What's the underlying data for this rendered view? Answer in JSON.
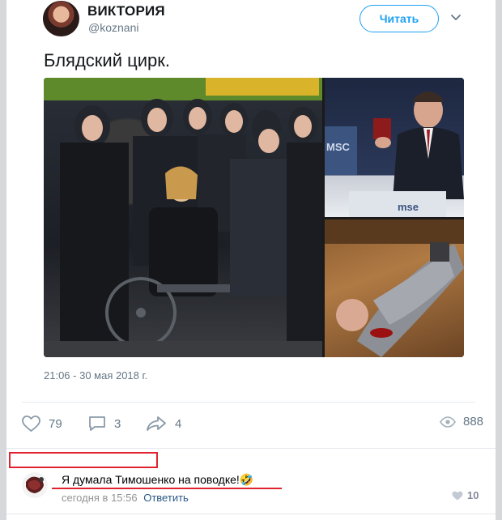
{
  "tweet": {
    "author_name": "ВИКТОРИЯ",
    "author_handle": "@koznani",
    "follow_label": "Читать",
    "text": "Блядский цирк.",
    "timestamp": "21:06 - 30 мая 2018 г.",
    "media_labels": {
      "podium_left": "MSC",
      "podium_right": "mse"
    }
  },
  "actions": {
    "likes": "79",
    "comments": "3",
    "shares": "4",
    "views": "888",
    "icons": [
      "heart-icon",
      "comment-icon",
      "share-icon",
      "eye-icon"
    ]
  },
  "comment": {
    "text": "Я думала Тимошенко на поводке!",
    "emoji": "🤣",
    "time": "сегодня в 15:56",
    "reply_label": "Ответить",
    "likes": "10"
  },
  "colors": {
    "twitter_blue": "#1da1f2",
    "muted_text": "#657786",
    "annotation_red": "#e0242f",
    "vk_link": "#2a5885"
  }
}
